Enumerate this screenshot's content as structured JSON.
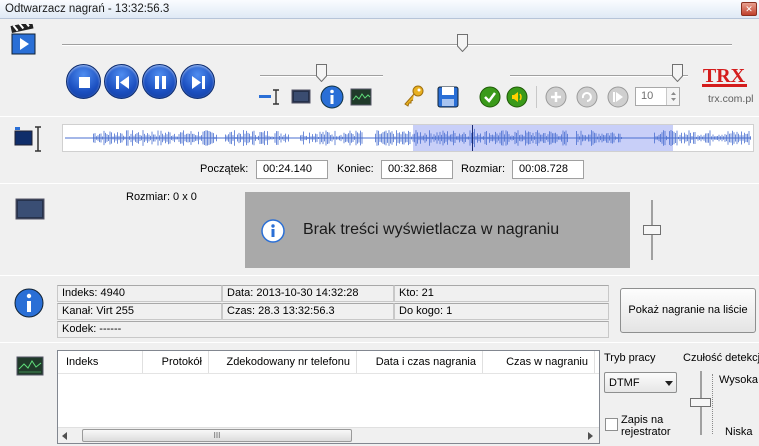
{
  "window": {
    "title": "Odtwarzacz nagrań - 13:32:56.3",
    "close_glyph": "✕"
  },
  "playback": {
    "position_fraction": 0.6,
    "buttons": [
      {
        "name": "stop-button",
        "icon": "stop-icon"
      },
      {
        "name": "previous-button",
        "icon": "skip-back-icon"
      },
      {
        "name": "pause-button",
        "icon": "pause-icon"
      },
      {
        "name": "next-button",
        "icon": "skip-forward-icon"
      }
    ]
  },
  "speed_slider_fraction": 0.5,
  "volume_slider_fraction": 0.97,
  "spinner": {
    "value": "10"
  },
  "brand": {
    "logo_text": "TRX",
    "url": "trx.com.pl"
  },
  "selection": {
    "start_label": "Początek:",
    "start_value": "00:24.140",
    "end_label": "Koniec:",
    "end_value": "00:32.868",
    "size_label": "Rozmiar:",
    "size_value": "00:08.728"
  },
  "display": {
    "size_label": "Rozmiar: 0 x 0",
    "no_content_message": "Brak treści wyświetlacza w nagraniu"
  },
  "info": {
    "index": "Indeks: 4940",
    "channel": "Kanał: Virt 255",
    "codec": "Kodek: ------",
    "date": "Data: 2013-10-30 14:32:28",
    "time": "Czas: 28.3 13:32:56.3",
    "who": "Kto: 21",
    "to_whom": "Do kogo: 1",
    "show_button": "Pokaż nagranie na liście"
  },
  "table": {
    "columns": [
      "Indeks",
      "Protokół",
      "Zdekodowany nr telefonu",
      "Data i czas nagrania",
      "Czas w nagraniu"
    ],
    "scroll_glyph": "III"
  },
  "mode": {
    "label": "Tryb pracy",
    "selected": "DTMF",
    "checkbox_label_1": "Zapis na",
    "checkbox_label_2": "rejestrator"
  },
  "sensitivity": {
    "label": "Czułość detekcji",
    "high": "Wysoka",
    "low": "Niska",
    "level_fraction": 0.55
  },
  "colors": {
    "accent_blue": "#1b4fc0",
    "waveform": "#4a6fd0",
    "selection": "#c8cff8"
  }
}
